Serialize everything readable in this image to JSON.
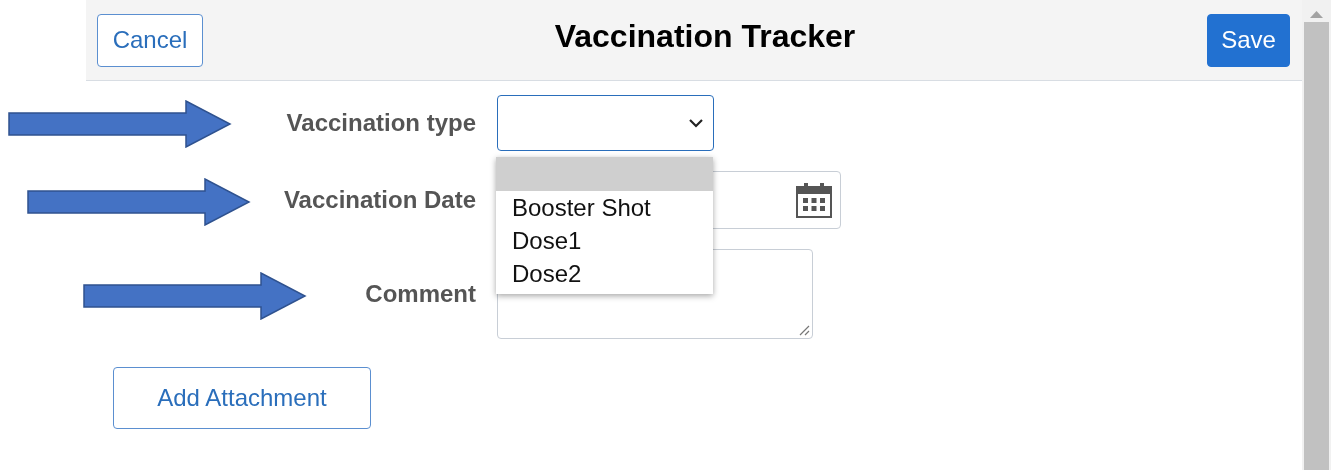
{
  "header": {
    "title": "Vaccination Tracker",
    "cancel_button": "Cancel",
    "save_button": "Save"
  },
  "fields": [
    {
      "kind": "select",
      "label": "Vaccination type",
      "annotated": true,
      "open": true,
      "options": [
        {
          "highlighted": true
        },
        {
          "label": "Booster Shot",
          "highlighted": false
        },
        {
          "label": "Dose1",
          "highlighted": false
        },
        {
          "label": "Dose2",
          "highlighted": false
        }
      ]
    },
    {
      "kind": "date",
      "label": "Vaccination Date",
      "annotated": true
    },
    {
      "kind": "textarea",
      "label": "Comment",
      "annotated": true
    }
  ],
  "attachment_button": "Add Attachment"
}
